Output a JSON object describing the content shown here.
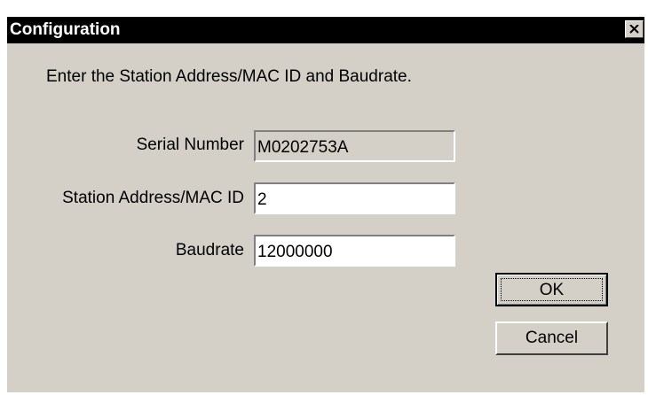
{
  "window": {
    "title": "Configuration",
    "close_icon": "close-icon"
  },
  "instruction": "Enter the Station Address/MAC ID and Baudrate.",
  "fields": {
    "serial_number": {
      "label": "Serial Number",
      "value": "M0202753A",
      "readonly": true
    },
    "station_address": {
      "label": "Station Address/MAC ID",
      "value": "2"
    },
    "baudrate": {
      "label": "Baudrate",
      "value": "12000000"
    }
  },
  "buttons": {
    "ok": "OK",
    "cancel": "Cancel"
  },
  "colors": {
    "dialog_face": "#d4d0c8",
    "title_bar": "#000000",
    "title_text": "#ffffff"
  }
}
